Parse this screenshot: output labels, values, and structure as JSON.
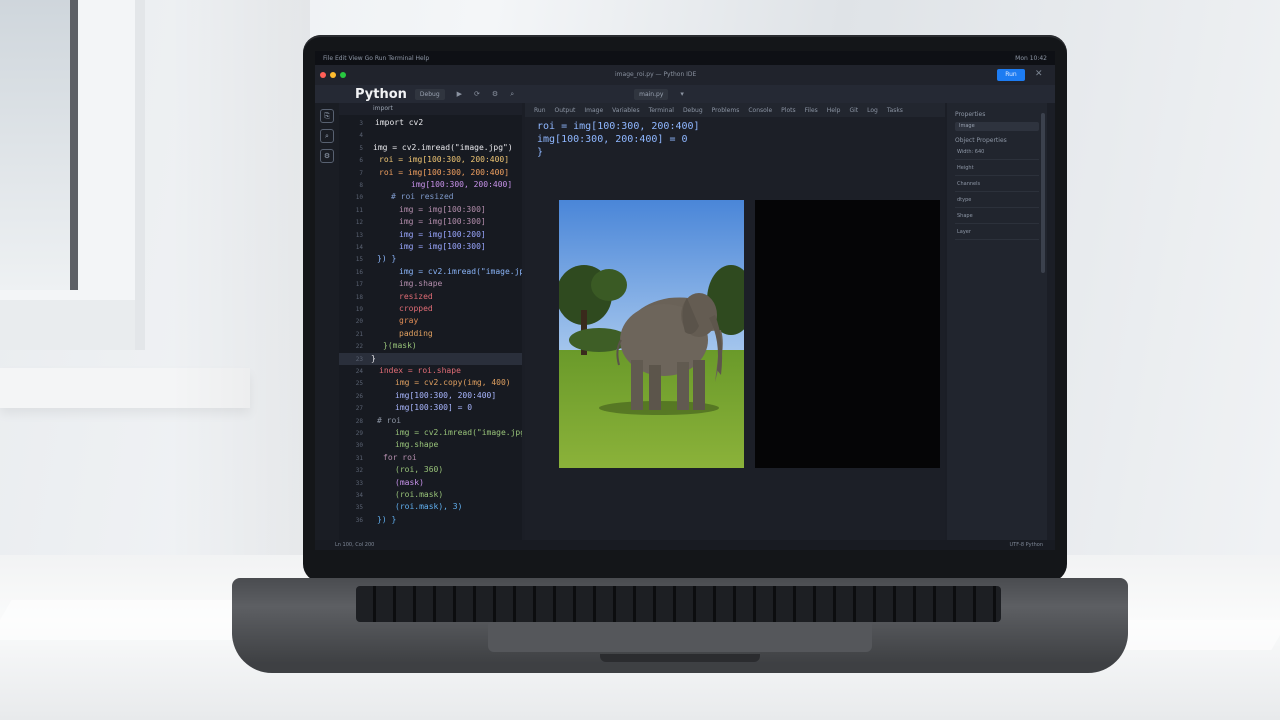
{
  "os_bar": {
    "left": "File Edit View Go Run Terminal Help",
    "right": "Mon 10:42"
  },
  "window": {
    "title": "image_roi.py — Python IDE",
    "run_label": "Run",
    "close": "✕"
  },
  "toolbar": {
    "brand": "Python",
    "button": "Debug",
    "icons": [
      "▶",
      "⟳",
      "⚙",
      "⌕"
    ],
    "tabs": [
      "main.py",
      "▾"
    ]
  },
  "activity": [
    "⎘",
    "⌕",
    "⚙"
  ],
  "editor": {
    "tab": "import",
    "lines": [
      {
        "n": "3",
        "text": "import cv2",
        "color": "#e8e8ec",
        "indent": 8
      },
      {
        "n": "4",
        "text": "",
        "color": "#e8e8ec",
        "indent": 8
      },
      {
        "n": "5",
        "text": "img = cv2.imread(\"image.jpg\")",
        "color": "#e8e8ec",
        "indent": 6
      },
      {
        "n": "6",
        "text": "roi = img[100:300, 200:400]",
        "color": "#f0c674",
        "indent": 12
      },
      {
        "n": "7",
        "text": "roi = img[100:300, 200:400]",
        "color": "#f0a060",
        "indent": 12
      },
      {
        "n": "8",
        "text": "img[100:300, 200:400]",
        "color": "#c792ea",
        "indent": 44
      },
      {
        "n": "10",
        "text": "# roi resized",
        "color": "#7f9acb",
        "indent": 24
      },
      {
        "n": "11",
        "text": "img = img[100:300]",
        "color": "#b48ead",
        "indent": 32
      },
      {
        "n": "12",
        "text": "img = img[100:300]",
        "color": "#b48ead",
        "indent": 32
      },
      {
        "n": "13",
        "text": "img = img[100:200]",
        "color": "#9aa7ff",
        "indent": 32
      },
      {
        "n": "14",
        "text": "img = img[100:300]",
        "color": "#9aa7ff",
        "indent": 32
      },
      {
        "n": "15",
        "text": "})  }",
        "color": "#8ab4f8",
        "indent": 10
      },
      {
        "n": "16",
        "text": "img = cv2.imread(\"image.jpg\")",
        "color": "#8ab4f8",
        "indent": 32
      },
      {
        "n": "17",
        "text": "img.shape",
        "color": "#b48ead",
        "indent": 32
      },
      {
        "n": "18",
        "text": "resized",
        "color": "#e06c75",
        "indent": 32
      },
      {
        "n": "19",
        "text": "cropped",
        "color": "#e06c75",
        "indent": 32
      },
      {
        "n": "20",
        "text": "gray",
        "color": "#e08c55",
        "indent": 32
      },
      {
        "n": "21",
        "text": "padding",
        "color": "#e0a060",
        "indent": 32
      },
      {
        "n": "22",
        "text": "}(mask)",
        "color": "#98c379",
        "indent": 16
      },
      {
        "n": "23",
        "text": "}",
        "color": "#e8e8ec",
        "indent": 4
      },
      {
        "n": "24",
        "text": "index = roi.shape",
        "color": "#e06c75",
        "indent": 12
      },
      {
        "n": "25",
        "text": "img = cv2.copy(img, 400)",
        "color": "#e0a060",
        "indent": 28
      },
      {
        "n": "26",
        "text": "img[100:300, 200:400]",
        "color": "#a9b7ff",
        "indent": 28
      },
      {
        "n": "27",
        "text": "img[100:300] = 0",
        "color": "#a9b7ff",
        "indent": 28
      },
      {
        "n": "28",
        "text": "# roi",
        "color": "#8b93a1",
        "indent": 10
      },
      {
        "n": "29",
        "text": "img = cv2.imread(\"image.jpg\")",
        "color": "#98c379",
        "indent": 28
      },
      {
        "n": "30",
        "text": "img.shape",
        "color": "#98c379",
        "indent": 28
      },
      {
        "n": "31",
        "text": "for roi",
        "color": "#b48ead",
        "indent": 16
      },
      {
        "n": "32",
        "text": "(roi, 360)",
        "color": "#98c379",
        "indent": 28
      },
      {
        "n": "33",
        "text": "(mask)",
        "color": "#c792ea",
        "indent": 28
      },
      {
        "n": "34",
        "text": "(roi.mask)",
        "color": "#98c379",
        "indent": 28
      },
      {
        "n": "35",
        "text": "(roi.mask), 3)",
        "color": "#61afef",
        "indent": 28
      },
      {
        "n": "36",
        "text": "})  }",
        "color": "#61afef",
        "indent": 10
      }
    ]
  },
  "preview": {
    "tabs": [
      "Run",
      "Output",
      "Image",
      "Variables",
      "Terminal",
      "Debug",
      "Problems",
      "Console",
      "Plots",
      "Files",
      "Help",
      "Git",
      "Log",
      "Tasks"
    ],
    "code": [
      "roi = img[100:300, 200:400]",
      "img[100:300, 200:400] = 0",
      "}"
    ]
  },
  "right_panel": {
    "title": "Properties",
    "select": "Image",
    "header": "Object Properties",
    "items": [
      "Width: 640",
      "Height",
      "Channels",
      "dtype",
      "Shape",
      "Layer"
    ]
  },
  "status": {
    "left": "Ln 100, Col 200",
    "right": "UTF-8  Python"
  }
}
